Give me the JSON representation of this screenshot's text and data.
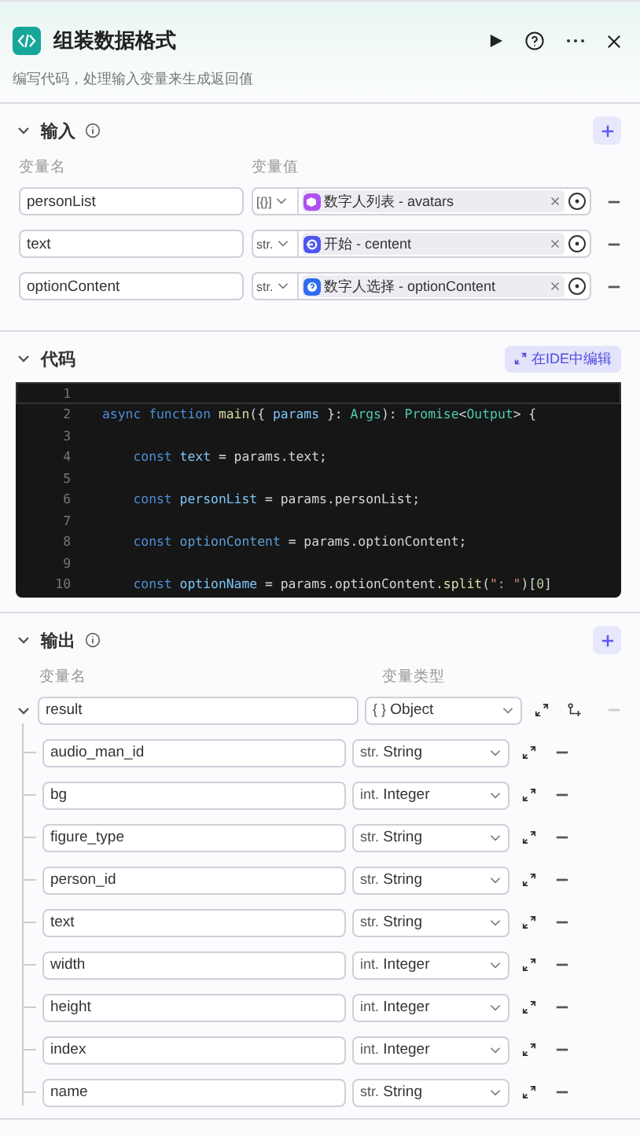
{
  "header": {
    "title": "组装数据格式",
    "description": "编写代码，处理输入变量来生成返回值"
  },
  "input": {
    "title": "输入",
    "expanded": true,
    "columns": [
      "变量名",
      "变量值"
    ],
    "rows": [
      {
        "name": "personList",
        "type": "[{}]",
        "ref": "数字人列表 - avatars",
        "kind": "cube",
        "color": "#b04ff0"
      },
      {
        "name": "text",
        "type": "str.",
        "ref": "开始 - centent",
        "kind": "start",
        "color": "#4f55f0"
      },
      {
        "name": "optionContent",
        "type": "str.",
        "ref": "数字人选择 - optionContent",
        "kind": "question",
        "color": "#2f6bf0"
      }
    ]
  },
  "code": {
    "title": "代码",
    "expanded": true,
    "ide_button": "在IDE中编辑",
    "lines": [
      {
        "number": "1",
        "current": true
      },
      {
        "number": "2",
        "current": false,
        "tokens": [
          {
            "text": "async function ",
            "kind": "keyword"
          },
          {
            "text": "main",
            "kind": "fn"
          },
          {
            "text": "({ ",
            "kind": "plain"
          },
          {
            "text": "params",
            "kind": "var"
          },
          {
            "text": " }: ",
            "kind": "plain"
          },
          {
            "text": "Args",
            "kind": "type"
          },
          {
            "text": "): ",
            "kind": "plain"
          },
          {
            "text": "Promise",
            "kind": "type"
          },
          {
            "text": "<",
            "kind": "plain"
          },
          {
            "text": "Output",
            "kind": "type"
          },
          {
            "text": "> {",
            "kind": "plain"
          }
        ]
      },
      {
        "number": "3",
        "current": false
      },
      {
        "number": "4",
        "current": false,
        "tokens": [
          {
            "text": "    const ",
            "kind": "keyword"
          },
          {
            "text": "text",
            "kind": "var"
          },
          {
            "text": " = params.text;",
            "kind": "plain"
          }
        ]
      },
      {
        "number": "5",
        "current": false
      },
      {
        "number": "6",
        "current": false,
        "tokens": [
          {
            "text": "    const ",
            "kind": "keyword"
          },
          {
            "text": "personList",
            "kind": "var"
          },
          {
            "text": " = params.personList;",
            "kind": "plain"
          }
        ]
      },
      {
        "number": "7",
        "current": false
      },
      {
        "number": "8",
        "current": false,
        "tokens": [
          {
            "text": "    const ",
            "kind": "keyword"
          },
          {
            "text": "optionContent",
            "kind": "var2"
          },
          {
            "text": " = params.optionContent;",
            "kind": "plain"
          }
        ]
      },
      {
        "number": "9",
        "current": false
      },
      {
        "number": "10",
        "current": false,
        "tokens": [
          {
            "text": "    const ",
            "kind": "keyword"
          },
          {
            "text": "optionName",
            "kind": "var"
          },
          {
            "text": " = params.optionContent.",
            "kind": "plain"
          },
          {
            "text": "split",
            "kind": "fn"
          },
          {
            "text": "(",
            "kind": "plain"
          },
          {
            "text": "\": \"",
            "kind": "string"
          },
          {
            "text": ")[",
            "kind": "plain"
          },
          {
            "text": "0",
            "kind": "number"
          },
          {
            "text": "]",
            "kind": "plain"
          }
        ]
      }
    ]
  },
  "output": {
    "title": "输出",
    "expanded": true,
    "columns": [
      "变量名",
      "变量类型"
    ],
    "root": {
      "name": "result",
      "type_tag": "{ }",
      "type": "Object",
      "expanded": true,
      "removable": false,
      "children": [
        {
          "name": "audio_man_id",
          "type_tag": "str.",
          "type": "String",
          "removable": true
        },
        {
          "name": "bg",
          "type_tag": "int.",
          "type": "Integer",
          "removable": true
        },
        {
          "name": "figure_type",
          "type_tag": "str.",
          "type": "String",
          "removable": true
        },
        {
          "name": "person_id",
          "type_tag": "str.",
          "type": "String",
          "removable": true
        },
        {
          "name": "text",
          "type_tag": "str.",
          "type": "String",
          "removable": true
        },
        {
          "name": "width",
          "type_tag": "int.",
          "type": "Integer",
          "removable": true
        },
        {
          "name": "height",
          "type_tag": "int.",
          "type": "Integer",
          "removable": true
        },
        {
          "name": "index",
          "type_tag": "int.",
          "type": "Integer",
          "removable": true
        },
        {
          "name": "name",
          "type_tag": "str.",
          "type": "String",
          "removable": true
        }
      ]
    }
  }
}
